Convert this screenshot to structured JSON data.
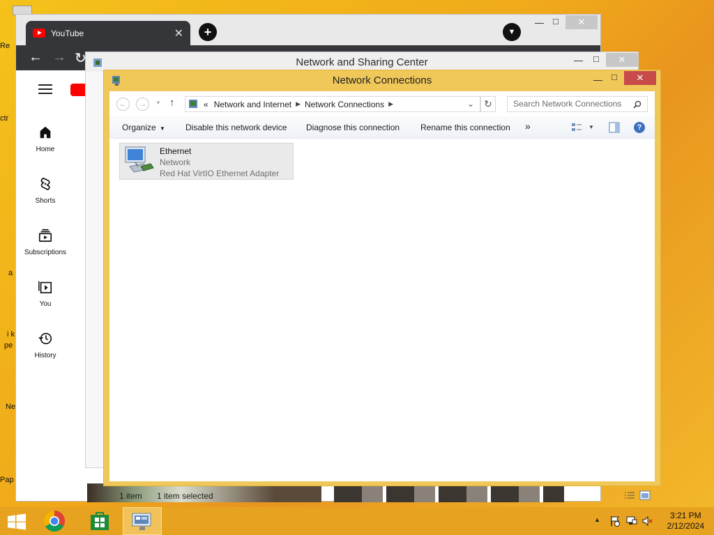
{
  "desktop": {
    "icon_labels": [
      "Re",
      "ctr",
      "a",
      "i k",
      "pe",
      "Ne",
      "Pap"
    ]
  },
  "chrome": {
    "tab_title": "YouTube",
    "tab_close": "✕",
    "new_tab": "+",
    "youtube_sidebar": [
      {
        "label": "Home",
        "icon": "home-icon"
      },
      {
        "label": "Shorts",
        "icon": "shorts-icon"
      },
      {
        "label": "Subscriptions",
        "icon": "subscriptions-icon"
      },
      {
        "label": "You",
        "icon": "you-icon"
      },
      {
        "label": "History",
        "icon": "history-icon"
      }
    ]
  },
  "nsc": {
    "title": "Network and Sharing Center"
  },
  "nc": {
    "title": "Network Connections",
    "breadcrumb": {
      "prefix": "«",
      "items": [
        "Network and Internet",
        "Network Connections"
      ]
    },
    "search_placeholder": "Search Network Connections",
    "commands": {
      "organize": "Organize",
      "disable": "Disable this network device",
      "diagnose": "Diagnose this connection",
      "rename": "Rename this connection",
      "more": "»"
    },
    "adapter": {
      "name": "Ethernet",
      "network": "Network",
      "device": "Red Hat VirtIO Ethernet Adapter"
    },
    "status": {
      "count": "1 item",
      "selected": "1 item selected"
    }
  },
  "taskbar": {
    "time": "3:21 PM",
    "date": "2/12/2024"
  },
  "colors": {
    "desktop": "#f0a81a",
    "window_frame_active": "#f0c85a",
    "close_red": "#c84a4a",
    "youtube_red": "#ff0000"
  }
}
